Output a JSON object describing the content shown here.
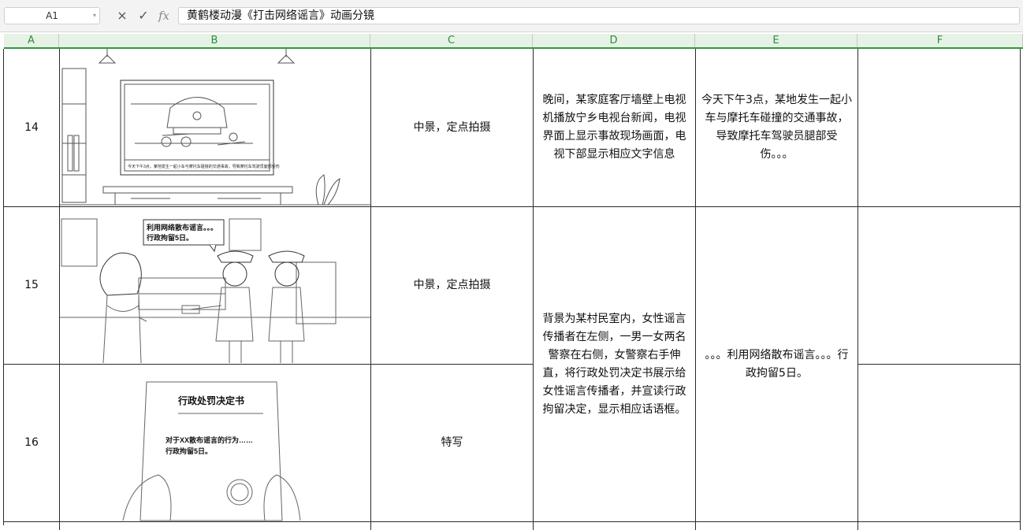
{
  "formula_bar": {
    "name_box": "A1",
    "cancel_icon": "×",
    "confirm_icon": "✓",
    "fx_label": "fx",
    "content": "黄鹤楼动漫《打击网络谣言》动画分镜"
  },
  "columns": [
    "A",
    "B",
    "C",
    "D",
    "E",
    "F"
  ],
  "rows": [
    {
      "num": "14",
      "shot": "中景，定点拍摄",
      "description": "晚间，某家庭客厅墙壁上电视机播放宁乡电视台新闻，电视界面上显示事故现场画面，电视下部显示相应文字信息",
      "dialogue": "今天下午3点，某地发生一起小车与摩托车碰撞的交通事故，导致摩托车驾驶员腿部受伤。。。",
      "tv_caption": "今天下午3点，某地发生一起小车与摩托车碰撞的交通事故，导致摩托车驾驶员腿部受伤"
    },
    {
      "num": "15",
      "shot": "中景，定点拍摄",
      "bubble_line1": "利用网络散布谣言。。。",
      "bubble_line2": "行政拘留5日。"
    },
    {
      "num": "16",
      "shot": "特写",
      "doc_title": "行政处罚决定书",
      "doc_line1": "对于XX散布谣言的行为……",
      "doc_line2": "行政拘留5日。"
    }
  ],
  "merged": {
    "description_15_16": "背景为某村民室内，女性谣言传播者在左侧，一男一女两名警察在右侧，女警察右手伸直，将行政处罚决定书展示给女性谣言传播者，并宣读行政拘留决定，显示相应话语框。",
    "dialogue_15_16": "。。。利用网络散布谣言。。。行政拘留5日。"
  },
  "colors": {
    "header_bg": "#e6f2e6",
    "header_text": "#2e8b3e",
    "accent": "#2e9a3e",
    "grid": "#2a2a2a"
  }
}
